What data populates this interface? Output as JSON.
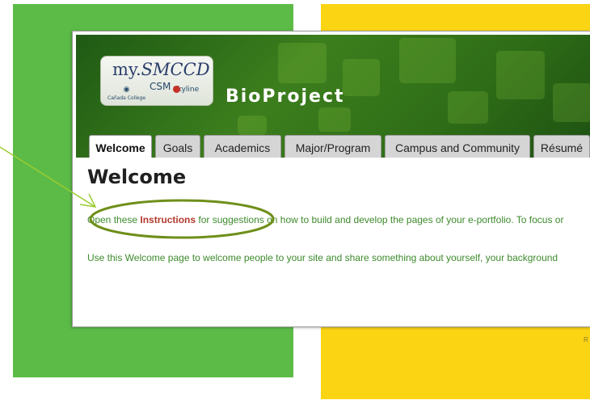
{
  "logo": {
    "brand_prefix": "my.",
    "brand_name": "SMCCD",
    "colleges": [
      "Cañada College",
      "CSM",
      "Skyline"
    ]
  },
  "site": {
    "title": "BioProject"
  },
  "tabs": [
    {
      "label": "Welcome",
      "active": true
    },
    {
      "label": "Goals",
      "active": false
    },
    {
      "label": "Academics",
      "active": false
    },
    {
      "label": "Major/Program",
      "active": false
    },
    {
      "label": "Campus and Community",
      "active": false
    },
    {
      "label": "Résumé",
      "active": false
    }
  ],
  "page": {
    "heading": "Welcome",
    "para1_before": "Open these ",
    "para1_link": "Instructions",
    "para1_after": " for suggestions on how to build and develop the pages of your e-portfolio.  To focus or",
    "para2": "Use this Welcome page to welcome people to your site and share something about yourself, your background"
  },
  "footer": {
    "text": "R"
  },
  "colors": {
    "background_green": "#5cbb47",
    "background_yellow": "#fbd414",
    "banner_green": "#2f6e17",
    "link_red": "#b33a2e",
    "body_text_green": "#3d8a2c",
    "annotation": "#9acd32"
  }
}
